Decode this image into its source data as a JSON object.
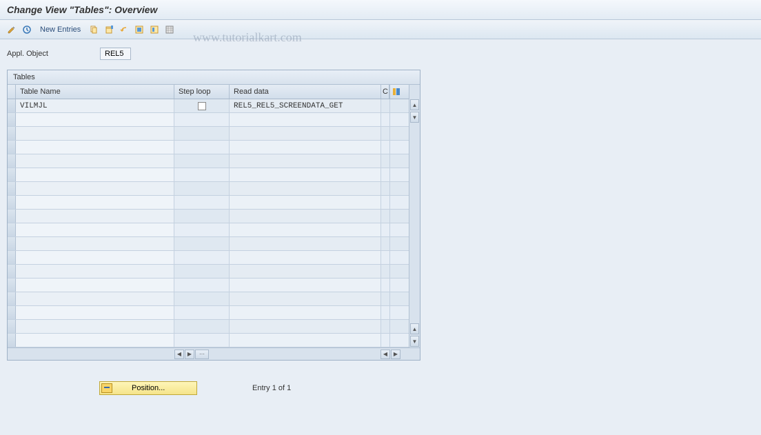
{
  "title": "Change View \"Tables\": Overview",
  "toolbar": {
    "new_entries_label": "New Entries"
  },
  "fields": {
    "appl_object_label": "Appl. Object",
    "appl_object_value": "REL5"
  },
  "table": {
    "title": "Tables",
    "columns": {
      "table_name": "Table Name",
      "step_loop": "Step loop",
      "read_data": "Read data",
      "c": "C"
    },
    "rows": [
      {
        "table_name": "VILMJL",
        "step_loop": false,
        "read_data": "REL5_REL5_SCREENDATA_GET"
      }
    ]
  },
  "footer": {
    "position_label": "Position...",
    "entry_text": "Entry 1 of 1"
  },
  "watermark": "www.tutorialkart.com"
}
